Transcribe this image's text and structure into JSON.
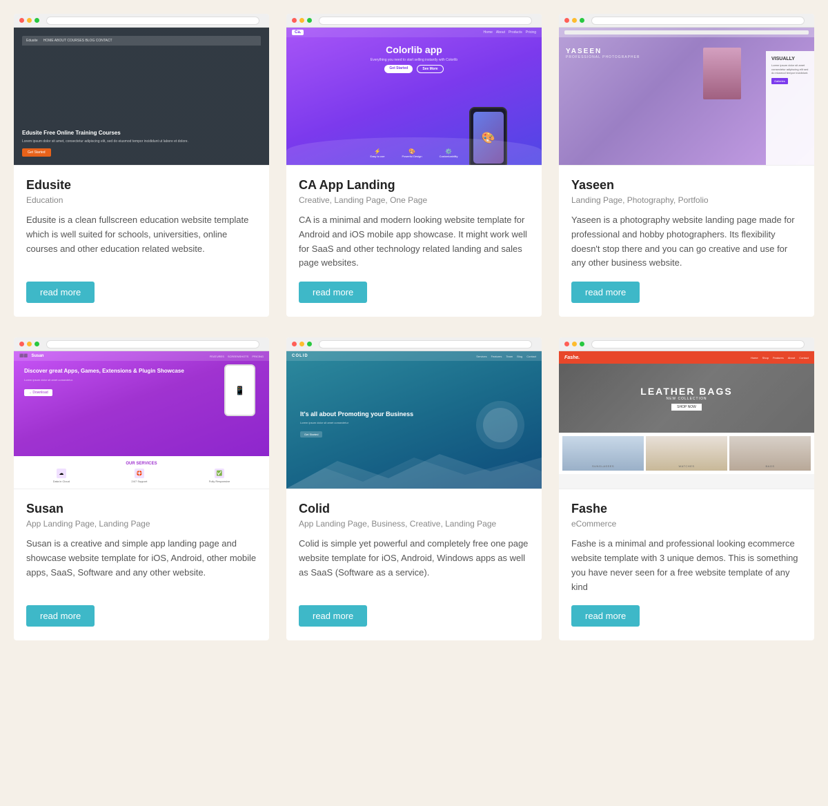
{
  "cards": [
    {
      "id": "edusite",
      "title": "Edusite",
      "tags": "Education",
      "desc": "Edusite is a clean fullscreen education website template which is well suited for schools, universities, online courses and other education related website.",
      "btn": "read more",
      "thumb_type": "edusite"
    },
    {
      "id": "ca-app-landing",
      "title": "CA App Landing",
      "tags": "Creative, Landing Page, One Page",
      "desc": "CA is a minimal and modern looking website template for Android and iOS mobile app showcase. It might work well for SaaS and other technology related landing and sales page websites.",
      "btn": "read more",
      "thumb_type": "ca"
    },
    {
      "id": "yaseen",
      "title": "Yaseen",
      "tags": "Landing Page, Photography, Portfolio",
      "desc": "Yaseen is a photography website landing page made for professional and hobby photographers. Its flexibility doesn't stop there and you can go creative and use for any other business website.",
      "btn": "read more",
      "thumb_type": "yaseen"
    },
    {
      "id": "susan",
      "title": "Susan",
      "tags": "App Landing Page, Landing Page",
      "desc": "Susan is a creative and simple app landing page and showcase website template for iOS, Android, other mobile apps, SaaS, Software and any other website.",
      "btn": "read more",
      "thumb_type": "susan"
    },
    {
      "id": "colid",
      "title": "Colid",
      "tags": "App Landing Page, Business, Creative, Landing Page",
      "desc": "Colid is simple yet powerful and completely free one page website template for iOS, Android, Windows apps as well as SaaS (Software as a service).",
      "btn": "read more",
      "thumb_type": "colid"
    },
    {
      "id": "fashe",
      "title": "Fashe",
      "tags": "eCommerce",
      "desc": "Fashe is a minimal and professional looking ecommerce website template with 3 unique demos. This is something you have never seen for a free website template of any kind",
      "btn": "read more",
      "thumb_type": "fashe"
    }
  ]
}
